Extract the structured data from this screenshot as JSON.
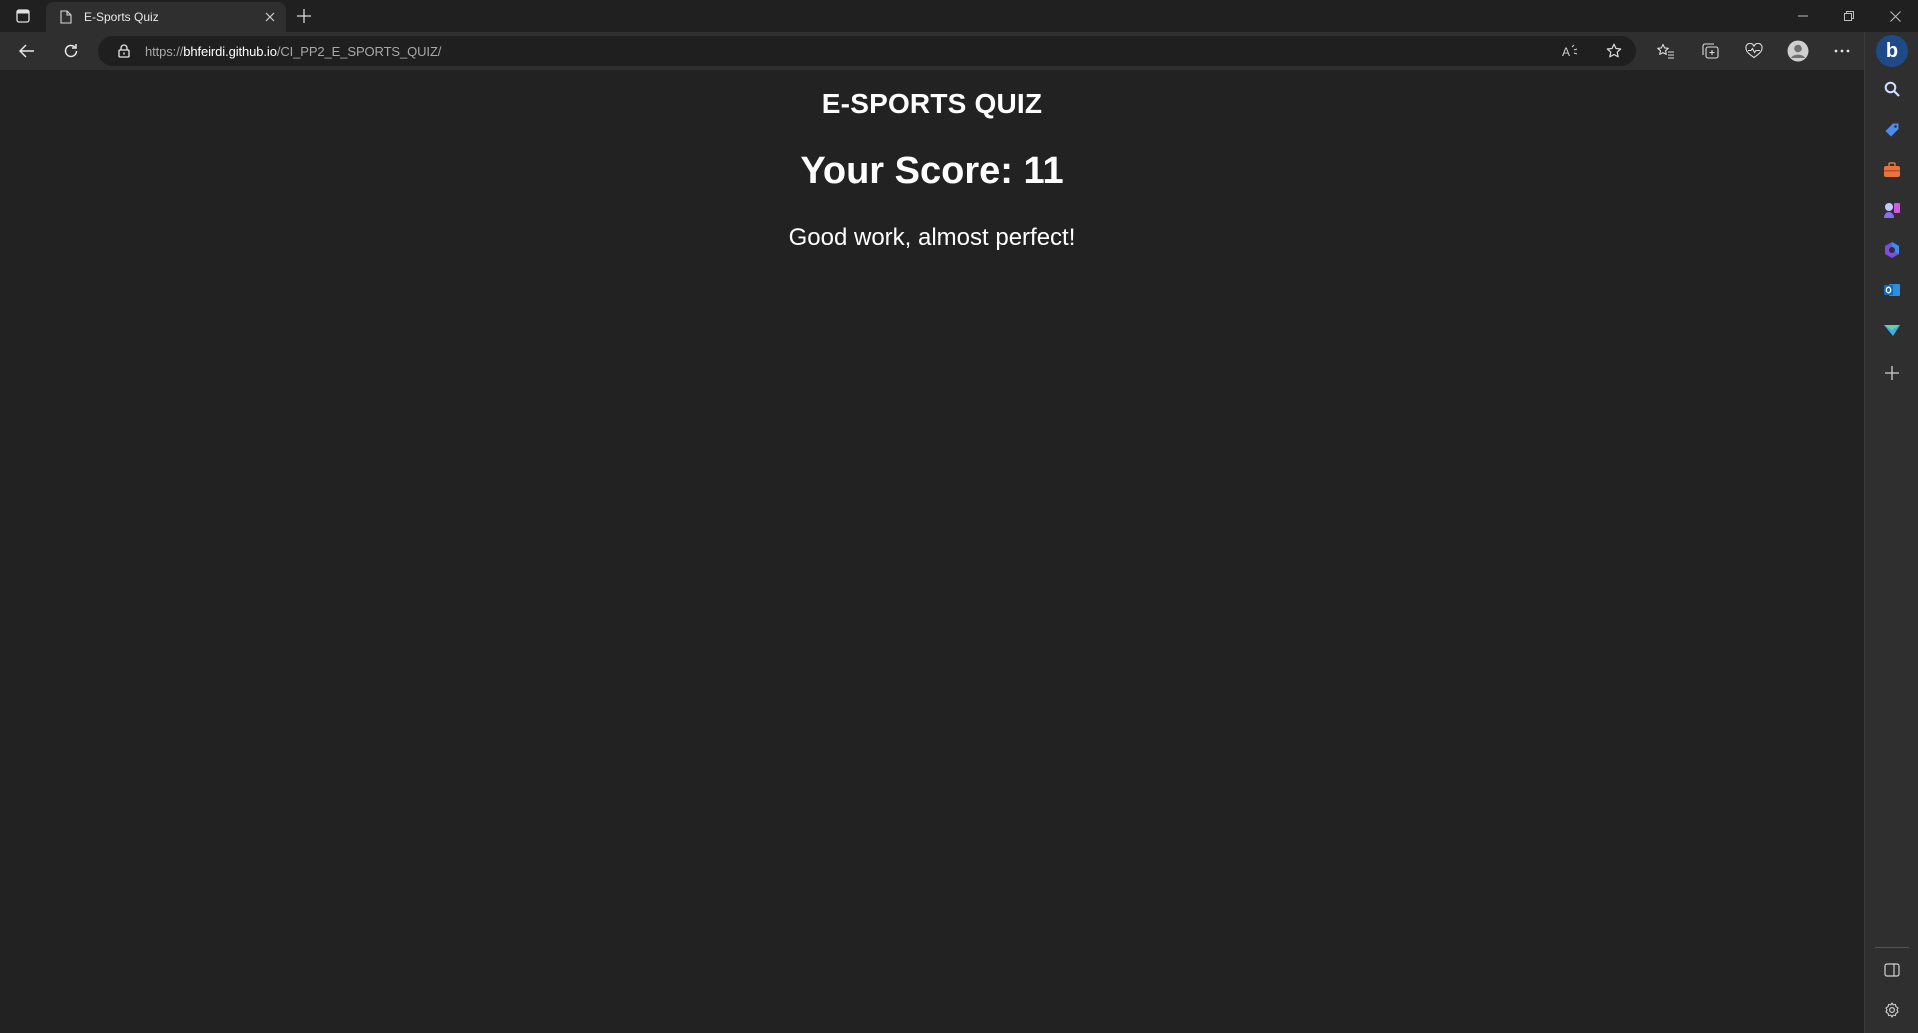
{
  "browser": {
    "tab": {
      "title": "E-Sports Quiz",
      "favicon_icon": "page-icon",
      "close_icon": "close-icon"
    },
    "new_tab_icon": "plus-icon",
    "window_controls": [
      "minimize-icon",
      "restore-icon",
      "close-icon"
    ],
    "address": {
      "protocol": "https://",
      "host": "bhfeirdi.github.io",
      "path": "/CI_PP2_E_SPORTS_QUIZ/"
    },
    "toolbar_icons": [
      "back-arrow-icon",
      "refresh-icon",
      "lock-icon",
      "read-aloud-icon",
      "favorite-star-icon",
      "favorites-icon",
      "collections-icon",
      "browser-essentials-icon",
      "profile-avatar-icon",
      "more-menu-icon",
      "bing-icon"
    ],
    "sidebar_icons": [
      "search-icon",
      "shopping-tag-icon",
      "tools-briefcase-icon",
      "games-icon",
      "microsoft-365-icon",
      "outlook-icon",
      "drop-icon",
      "add-icon",
      "hide-sidebar-icon",
      "settings-gear-icon"
    ]
  },
  "page": {
    "title": "E-SPORTS QUIZ",
    "score_label": "Your Score:",
    "score_value": "11",
    "feedback": "Good work, almost perfect!"
  },
  "colors": {
    "page_background": "#222222",
    "chrome_background": "#2f2f2f",
    "text": "#ffffff"
  }
}
